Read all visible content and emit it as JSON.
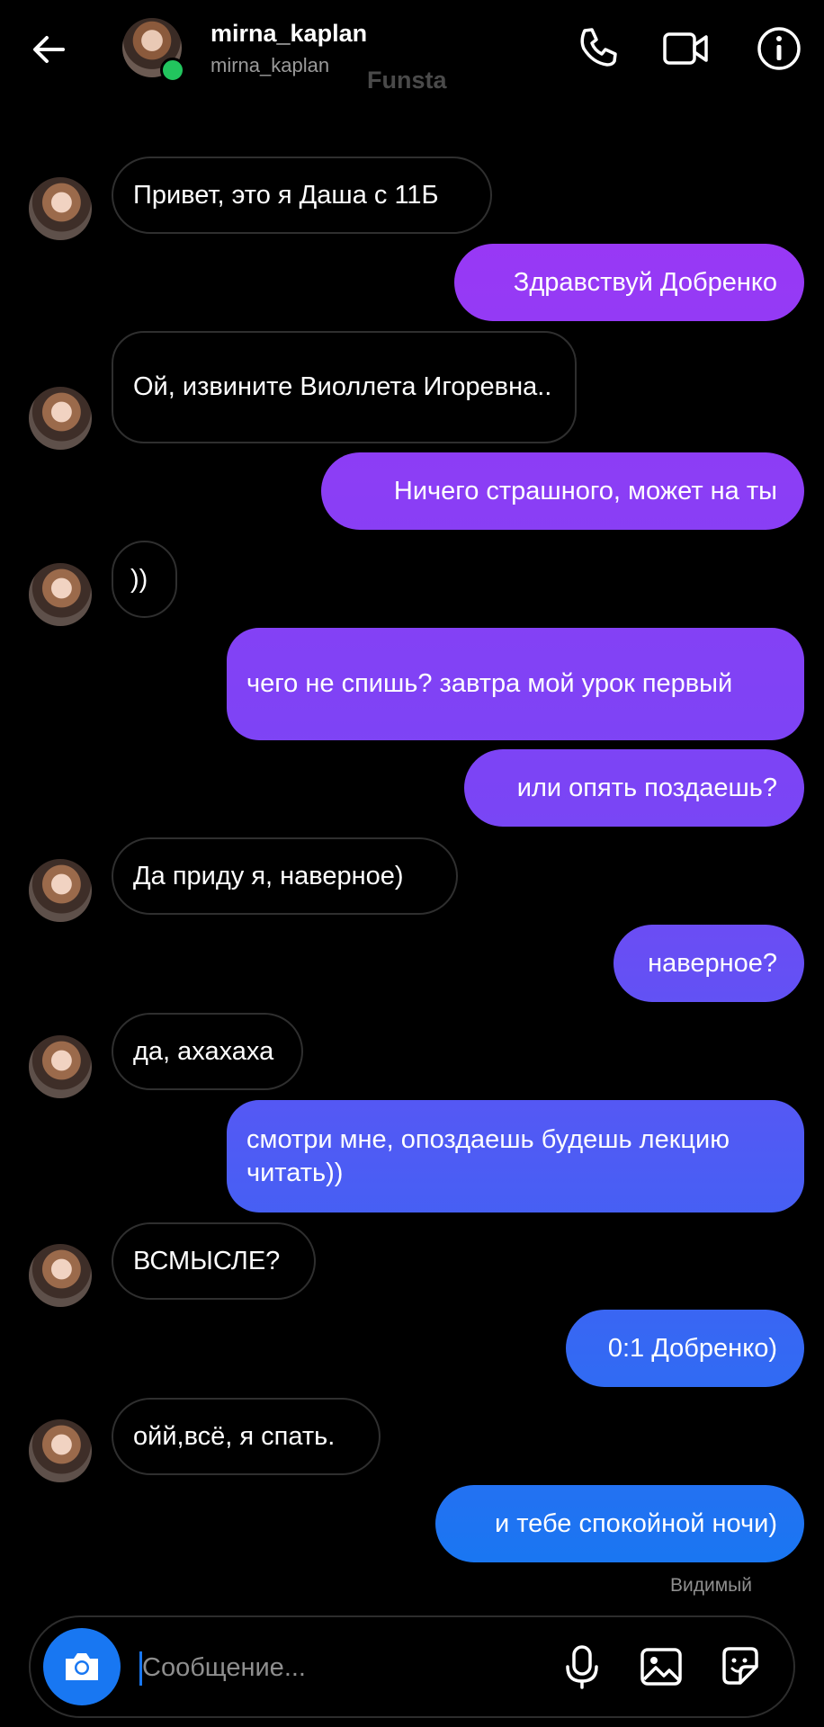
{
  "header": {
    "name": "mirna_kaplan",
    "username": "mirna_kaplan",
    "tag": "Funsta"
  },
  "messages": [
    {
      "dir": "in",
      "text": "Привет, это я Даша с 11Б"
    },
    {
      "dir": "out",
      "text": "Здравствуй Добренко"
    },
    {
      "dir": "in",
      "text": "Ой, извините Виоллета Игоревна.."
    },
    {
      "dir": "out",
      "text": "Ничего страшного, может на ты"
    },
    {
      "dir": "in",
      "text": "))"
    },
    {
      "dir": "out",
      "text": "чего не спишь? завтра мой урок первый"
    },
    {
      "dir": "out",
      "text": "или опять поздаешь?"
    },
    {
      "dir": "in",
      "text": "Да приду я, наверное)"
    },
    {
      "dir": "out",
      "text": "наверное?"
    },
    {
      "dir": "in",
      "text": "да, ахахаха"
    },
    {
      "dir": "out",
      "text": "смотри мне, опоздаешь будешь лекцию читать))"
    },
    {
      "dir": "in",
      "text": "ВСМЫСЛЕ?"
    },
    {
      "dir": "out",
      "text": "0:1 Добренко)"
    },
    {
      "dir": "in",
      "text": "ойй,всё, я спать."
    },
    {
      "dir": "out",
      "text": "и тебе спокойной ночи)"
    }
  ],
  "seen_label": "Видимый",
  "composer": {
    "placeholder": "Сообщение..."
  },
  "colors": {
    "accent": "#1877f2",
    "online": "#22c55e",
    "gradient_top": "#a533f5",
    "gradient_bottom": "#1877f2"
  },
  "icons": [
    "back-arrow-icon",
    "phone-icon",
    "video-icon",
    "info-icon",
    "camera-icon",
    "microphone-icon",
    "gallery-icon",
    "sticker-icon"
  ]
}
